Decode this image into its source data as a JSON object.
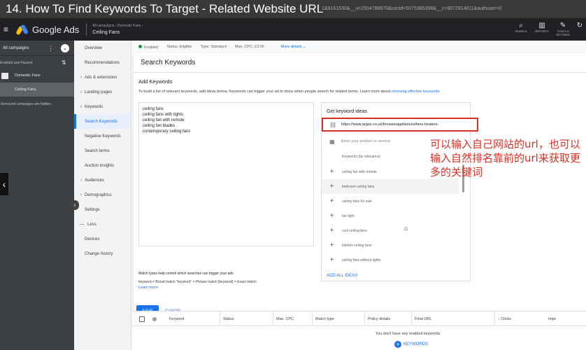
{
  "video": {
    "title": "14. How To Find Keywords To Target - Related Website URL",
    "url_fragment": "1&9161530&__u=2504788970&uscid=5075385398&__c=9072814611&authuser=0"
  },
  "topbar": {
    "product": "Google Ads",
    "breadcrumb_small": "All campaigns  ›  Domestic Fans  ›",
    "campaign": "Ceiling Fans",
    "icons": [
      {
        "name": "search-icon",
        "glyph": "⌕",
        "label": "SEARCH"
      },
      {
        "name": "reports-icon",
        "glyph": "▥",
        "label": "REPORTS"
      },
      {
        "name": "tools-icon",
        "glyph": "✎",
        "label": "TOOLS & SETTINGS"
      },
      {
        "name": "refresh-icon",
        "glyph": "↻",
        "label": ""
      }
    ]
  },
  "leftnav": {
    "all_campaigns": "All campaigns",
    "filter": "Enabled and Paused",
    "group": "Domestic Fans",
    "campaign": "Ceiling Fans",
    "removed": "Removed campaigns are hidden"
  },
  "subnav": {
    "items": [
      {
        "label": "Overview",
        "caret": false
      },
      {
        "label": "Recommendations",
        "caret": false
      },
      {
        "label": "Ads & extensions",
        "caret": true
      },
      {
        "label": "Landing pages",
        "caret": true
      },
      {
        "label": "Keywords",
        "caret": true
      },
      {
        "label": "Search Keywords",
        "active": true
      },
      {
        "label": "Negative Keywords"
      },
      {
        "label": "Search terms"
      },
      {
        "label": "Auction insights"
      },
      {
        "label": "Audiences",
        "caret": true
      },
      {
        "label": "Demographics",
        "caret": true
      },
      {
        "label": "Settings"
      },
      {
        "label": "Less",
        "less": true
      },
      {
        "label": "Devices"
      },
      {
        "label": "Change history"
      }
    ]
  },
  "status": {
    "enabled": "Enabled",
    "status": "Status: Eligible",
    "type": "Type: Standard",
    "max_cpc": "Max. CPC: £3.00",
    "more": "More details"
  },
  "card": {
    "title": "Search Keywords",
    "add_keywords": "Add Keywords",
    "instructions": "To build a list of relevant keywords, add ideas below. Keywords can trigger your ad to show when people search for related terms. Learn more about ",
    "instructions_link": "choosing effective keywords",
    "keywords_text": "ceiling fans\nceiling fans with lights\nceiling fan with remote\nceiling fan blades\ncontemporary ceiling fans",
    "ideas": {
      "title": "Get keyword ideas",
      "url": "https://www.argos.co.uk/browse/appliances/fans-heaters-",
      "product_placeholder": "Enter your product or service",
      "list_header": "Keywords (by relevance)",
      "list": [
        "ceiling fan with remote",
        "bedroom ceiling fans",
        "ceiling fans for sale",
        "fan light",
        "cool ceiling fans",
        "kitchen ceiling fans",
        "ceiling fans without lights"
      ],
      "add_all": "ADD ALL IDEAS"
    },
    "match_help": "Match types help control which searches can trigger your ads",
    "match_examples": "keyword = Broad match   \"keyword\" = Phrase match   [keyword] = Exact match",
    "learn_more": "Learn more",
    "save": "SAVE",
    "cancel": "CANCEL"
  },
  "annotation": "可以输入自己网站的url，也可以输入自然排名靠前的url来获取更多的关键词",
  "table": {
    "headers": [
      "Keyword",
      "Status",
      "Max. CPC",
      "Match type",
      "Policy details",
      "Final URL",
      "↓ Clicks",
      "Impr."
    ],
    "empty": "You don't have any enabled keywords",
    "add_btn": "KEYWORDS"
  }
}
